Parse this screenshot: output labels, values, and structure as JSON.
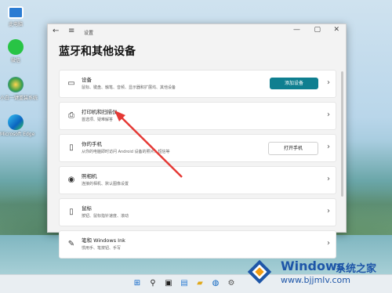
{
  "desktop": {
    "icons": [
      {
        "label": "此电脑",
        "icon": "computer-icon"
      },
      {
        "label": "微信",
        "icon": "wechat-icon"
      },
      {
        "label": "小白一键重装系统",
        "icon": "installer-icon"
      },
      {
        "label": "Microsoft Edge",
        "icon": "edge-icon"
      }
    ]
  },
  "window": {
    "title": "设置",
    "page_title": "蓝牙和其他设备",
    "controls": {
      "minimize": "—",
      "maximize": "▢",
      "close": "✕"
    }
  },
  "rows": [
    {
      "title": "设备",
      "subtitle": "鼠标、键盘、触笔、音频、显示器和扩展坞、其他设备",
      "button": "添加设备",
      "icon": "devices-icon"
    },
    {
      "title": "打印机和扫描仪",
      "subtitle": "首选项、疑难解答",
      "button": "",
      "icon": "printer-icon"
    },
    {
      "title": "你的手机",
      "subtitle": "从你的电脑即时访问 Android 设备的照片、短信等",
      "button": "打开手机",
      "icon": "phone-icon"
    },
    {
      "title": "照相机",
      "subtitle": "连接的相机、默认图像设置",
      "button": "",
      "icon": "camera-icon"
    },
    {
      "title": "鼠标",
      "subtitle": "按钮、鼠标指针速度、滚动",
      "button": "",
      "icon": "mouse-icon"
    },
    {
      "title": "笔和 Windows Ink",
      "subtitle": "惯用手、笔按钮、手写",
      "button": "",
      "icon": "pen-icon"
    }
  ],
  "watermark": {
    "brand": "Windows",
    "sub": "系统之家",
    "url": "www.bjjmlv.com"
  },
  "colors": {
    "accent": "#0f7f90",
    "arrow": "#e53935",
    "brand": "#1e56a8"
  }
}
